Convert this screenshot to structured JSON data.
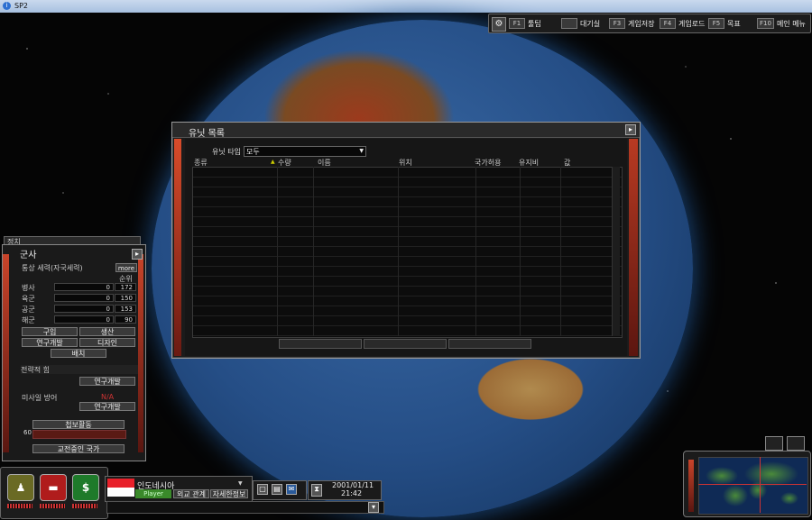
{
  "window": {
    "title": "SP2"
  },
  "function_bar": {
    "keys": [
      {
        "key": "F1",
        "label": "툴팁"
      },
      {
        "key": "",
        "label": "대기실"
      },
      {
        "key": "F3",
        "label": "게임저장"
      },
      {
        "key": "F4",
        "label": "게임로드"
      },
      {
        "key": "F5",
        "label": "목표"
      },
      {
        "key": "F10",
        "label": "메인 메뉴"
      }
    ]
  },
  "unit_list": {
    "title": "유닛 목록",
    "filter_label": "유닛 타입",
    "filter_value": "모두",
    "columns": [
      "종류",
      "수량",
      "이름",
      "위치",
      "국가허용",
      "유지비",
      "값"
    ],
    "buttons": [
      "",
      "",
      ""
    ]
  },
  "military": {
    "back_tab": "정치",
    "title": "군사",
    "section": "통상 세력(자국세력)",
    "more": "more",
    "rank_header": "순위",
    "rows": [
      {
        "label": "병사",
        "value": "0",
        "rank": "172"
      },
      {
        "label": "육군",
        "value": "0",
        "rank": "150"
      },
      {
        "label": "공군",
        "value": "0",
        "rank": "153"
      },
      {
        "label": "해군",
        "value": "0",
        "rank": "90"
      }
    ],
    "btn_buy": "구입",
    "btn_produce": "생산",
    "btn_research": "연구개발",
    "btn_design": "디자인",
    "btn_deploy": "배치",
    "strategic": "전략적 힘",
    "btn_research2": "연구개발",
    "missile": "미사일 방어",
    "missile_value": "N/A",
    "btn_research3": "연구개발",
    "btn_intel": "첩보활동",
    "pct": "60",
    "btn_war": "교전중인 국가"
  },
  "bottom": {
    "icons": [
      "soldier-icon",
      "tank-icon",
      "dollar-icon"
    ],
    "country": "인도네시아",
    "player": "Player",
    "btn_diplomacy": "외교 관계",
    "btn_details": "자세한정보",
    "date": "2001/01/11",
    "time": "21:42",
    "colors": {
      "flag_top": "#e8202a",
      "flag_bottom": "#ffffff",
      "accent_red": "#c8442a"
    }
  }
}
